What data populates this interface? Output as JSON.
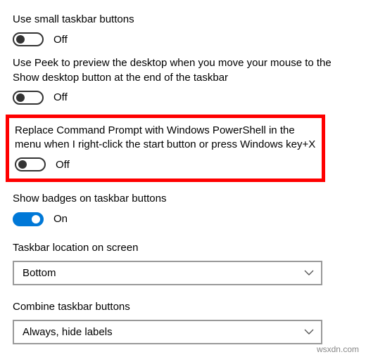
{
  "settings": {
    "small_buttons": {
      "label": "Use small taskbar buttons",
      "state_text": "Off",
      "on": false
    },
    "use_peek": {
      "label": "Use Peek to preview the desktop when you move your mouse to the Show desktop button at the end of the taskbar",
      "state_text": "Off",
      "on": false
    },
    "replace_cmd": {
      "label": "Replace Command Prompt with Windows PowerShell in the menu when I right-click the start button or press Windows key+X",
      "state_text": "Off",
      "on": false
    },
    "badges": {
      "label": "Show badges on taskbar buttons",
      "state_text": "On",
      "on": true
    }
  },
  "location": {
    "label": "Taskbar location on screen",
    "value": "Bottom"
  },
  "combine": {
    "label": "Combine taskbar buttons",
    "value": "Always, hide labels"
  },
  "watermark": "wsxdn.com"
}
